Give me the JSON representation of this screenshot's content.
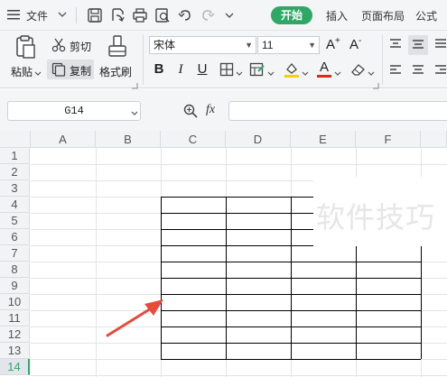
{
  "menubar": {
    "file_label": "文件",
    "tabs": [
      "开始",
      "插入",
      "页面布局",
      "公式"
    ],
    "active_tab": "开始",
    "active_color": "#2fa866"
  },
  "ribbon": {
    "paste_label": "粘贴",
    "cut_label": "剪切",
    "copy_label": "复制",
    "format_painter_label": "格式刷",
    "font_name": "宋体",
    "font_size": "11",
    "bold_label": "B",
    "italic_label": "I",
    "underline_label": "U",
    "font_color_label": "A",
    "grow_font_label": "A",
    "shrink_font_label": "A"
  },
  "formula_bar": {
    "cell_ref": "G14",
    "fx_label": "fx",
    "value": ""
  },
  "sheet": {
    "columns": [
      "A",
      "B",
      "C",
      "D",
      "E",
      "F"
    ],
    "rows": [
      "1",
      "2",
      "3",
      "4",
      "5",
      "6",
      "7",
      "8",
      "9",
      "10",
      "11",
      "12",
      "13",
      "14"
    ],
    "active_row": "14",
    "bordered_range": "C4:F13",
    "accent": "#2fa866",
    "arrow_color": "#e84a3b"
  },
  "watermark": {
    "text": "软件技巧"
  }
}
